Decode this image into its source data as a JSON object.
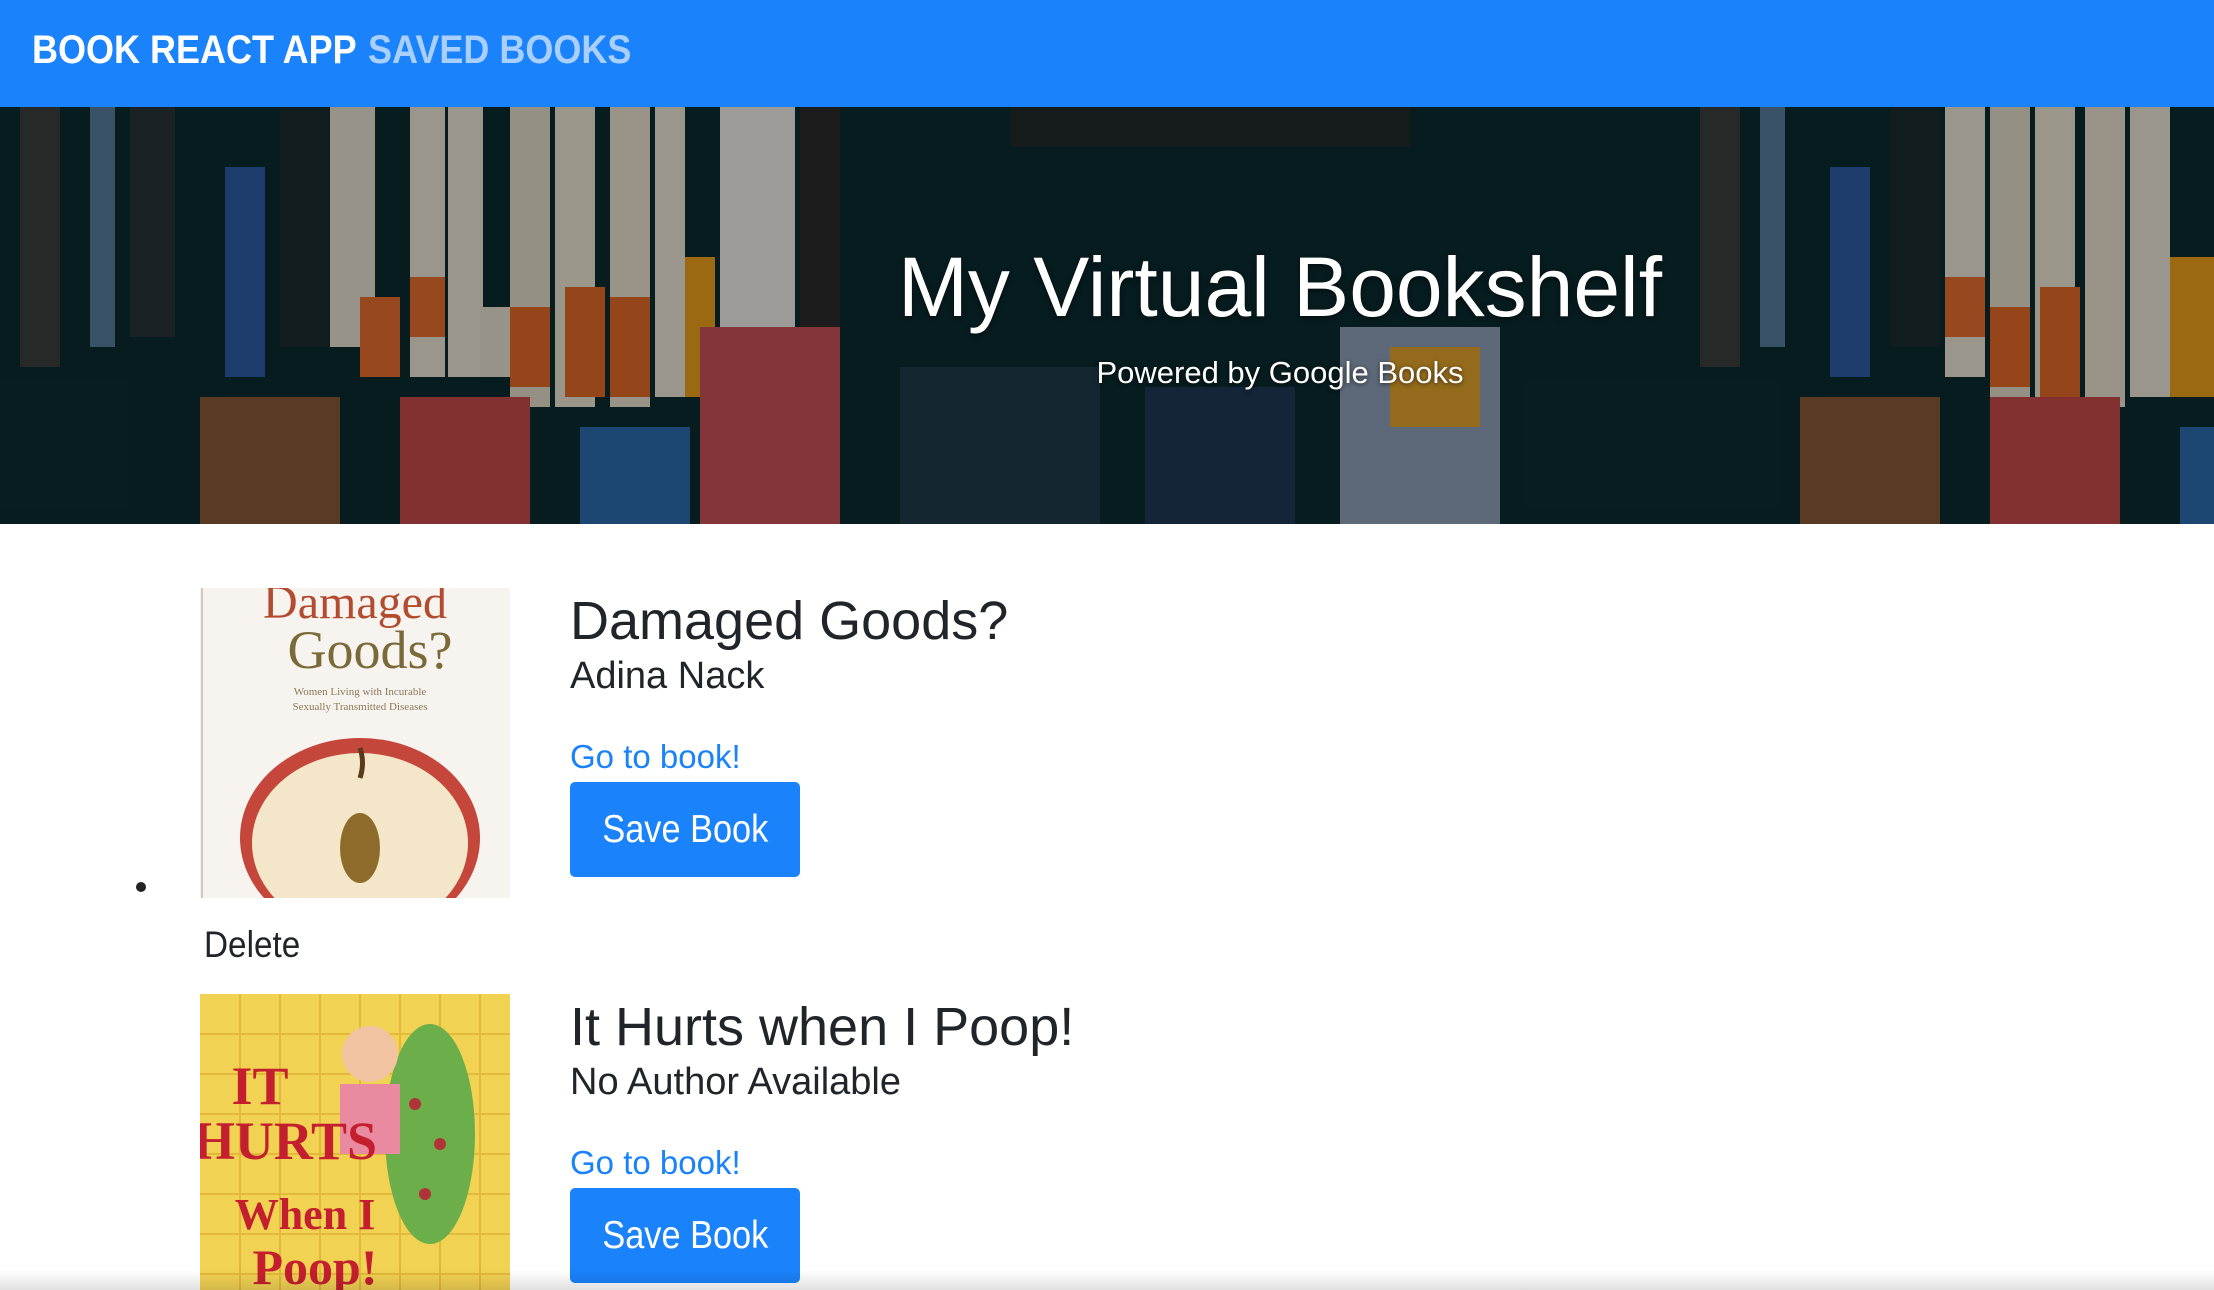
{
  "navbar": {
    "brand": "BOOK REACT APP",
    "saved_link": "SAVED BOOKS"
  },
  "hero": {
    "title": "My Virtual Bookshelf",
    "subtitle": "Powered by Google Books"
  },
  "books": [
    {
      "title": "Damaged Goods?",
      "author": "Adina Nack",
      "link_label": "Go to book!",
      "save_label": "Save Book",
      "cover_text": [
        "Damaged",
        "Goods?",
        "Women Living with Incurable",
        "Sexually Transmitted Diseases"
      ]
    },
    {
      "title": "It Hurts when I Poop!",
      "author": "No Author Available",
      "link_label": "Go to book!",
      "save_label": "Save Book",
      "cover_text": [
        "IT",
        "HURTS",
        "When I",
        "Poop!"
      ]
    }
  ],
  "delete_label": "Delete",
  "colors": {
    "navbar": "#1a82fa",
    "link": "#1a82fa",
    "button": "#1a82fa",
    "text": "#212529"
  }
}
